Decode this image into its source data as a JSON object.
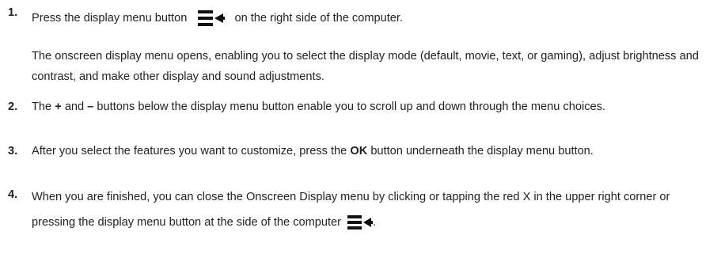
{
  "steps": [
    {
      "number": "1.",
      "part1": "Press the display menu button",
      "part2": "on the right side of the computer.",
      "paragraph": "The onscreen display menu opens, enabling you to select the display mode (default, movie, text, or gaming), adjust brightness and contrast, and make other display and sound adjustments."
    },
    {
      "number": "2.",
      "text_before": "The",
      "plus": "+",
      "text_mid": "and",
      "minus": "–",
      "text_after": "buttons below the display menu button enable you to scroll up and down through the menu choices."
    },
    {
      "number": "3.",
      "text_before": "After you select the features you want to customize, press the",
      "ok": "OK",
      "text_after": "button underneath the display menu button."
    },
    {
      "number": "4.",
      "line1": "When you are finished, you can close the Onscreen Display menu by clicking or tapping the red X in the",
      "line2": "upper right corner or pressing the display menu button at the side of the computer",
      "end": "."
    }
  ],
  "icons": {
    "display_menu": "display-menu-icon"
  }
}
